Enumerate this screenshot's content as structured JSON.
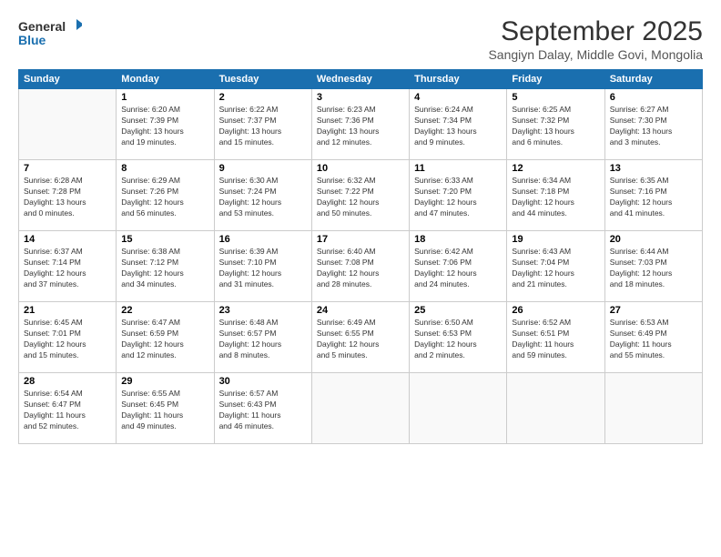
{
  "logo": {
    "line1": "General",
    "line2": "Blue"
  },
  "title": "September 2025",
  "subtitle": "Sangiyn Dalay, Middle Govi, Mongolia",
  "headers": [
    "Sunday",
    "Monday",
    "Tuesday",
    "Wednesday",
    "Thursday",
    "Friday",
    "Saturday"
  ],
  "weeks": [
    [
      {
        "day": "",
        "text": ""
      },
      {
        "day": "1",
        "text": "Sunrise: 6:20 AM\nSunset: 7:39 PM\nDaylight: 13 hours\nand 19 minutes."
      },
      {
        "day": "2",
        "text": "Sunrise: 6:22 AM\nSunset: 7:37 PM\nDaylight: 13 hours\nand 15 minutes."
      },
      {
        "day": "3",
        "text": "Sunrise: 6:23 AM\nSunset: 7:36 PM\nDaylight: 13 hours\nand 12 minutes."
      },
      {
        "day": "4",
        "text": "Sunrise: 6:24 AM\nSunset: 7:34 PM\nDaylight: 13 hours\nand 9 minutes."
      },
      {
        "day": "5",
        "text": "Sunrise: 6:25 AM\nSunset: 7:32 PM\nDaylight: 13 hours\nand 6 minutes."
      },
      {
        "day": "6",
        "text": "Sunrise: 6:27 AM\nSunset: 7:30 PM\nDaylight: 13 hours\nand 3 minutes."
      }
    ],
    [
      {
        "day": "7",
        "text": "Sunrise: 6:28 AM\nSunset: 7:28 PM\nDaylight: 13 hours\nand 0 minutes."
      },
      {
        "day": "8",
        "text": "Sunrise: 6:29 AM\nSunset: 7:26 PM\nDaylight: 12 hours\nand 56 minutes."
      },
      {
        "day": "9",
        "text": "Sunrise: 6:30 AM\nSunset: 7:24 PM\nDaylight: 12 hours\nand 53 minutes."
      },
      {
        "day": "10",
        "text": "Sunrise: 6:32 AM\nSunset: 7:22 PM\nDaylight: 12 hours\nand 50 minutes."
      },
      {
        "day": "11",
        "text": "Sunrise: 6:33 AM\nSunset: 7:20 PM\nDaylight: 12 hours\nand 47 minutes."
      },
      {
        "day": "12",
        "text": "Sunrise: 6:34 AM\nSunset: 7:18 PM\nDaylight: 12 hours\nand 44 minutes."
      },
      {
        "day": "13",
        "text": "Sunrise: 6:35 AM\nSunset: 7:16 PM\nDaylight: 12 hours\nand 41 minutes."
      }
    ],
    [
      {
        "day": "14",
        "text": "Sunrise: 6:37 AM\nSunset: 7:14 PM\nDaylight: 12 hours\nand 37 minutes."
      },
      {
        "day": "15",
        "text": "Sunrise: 6:38 AM\nSunset: 7:12 PM\nDaylight: 12 hours\nand 34 minutes."
      },
      {
        "day": "16",
        "text": "Sunrise: 6:39 AM\nSunset: 7:10 PM\nDaylight: 12 hours\nand 31 minutes."
      },
      {
        "day": "17",
        "text": "Sunrise: 6:40 AM\nSunset: 7:08 PM\nDaylight: 12 hours\nand 28 minutes."
      },
      {
        "day": "18",
        "text": "Sunrise: 6:42 AM\nSunset: 7:06 PM\nDaylight: 12 hours\nand 24 minutes."
      },
      {
        "day": "19",
        "text": "Sunrise: 6:43 AM\nSunset: 7:04 PM\nDaylight: 12 hours\nand 21 minutes."
      },
      {
        "day": "20",
        "text": "Sunrise: 6:44 AM\nSunset: 7:03 PM\nDaylight: 12 hours\nand 18 minutes."
      }
    ],
    [
      {
        "day": "21",
        "text": "Sunrise: 6:45 AM\nSunset: 7:01 PM\nDaylight: 12 hours\nand 15 minutes."
      },
      {
        "day": "22",
        "text": "Sunrise: 6:47 AM\nSunset: 6:59 PM\nDaylight: 12 hours\nand 12 minutes."
      },
      {
        "day": "23",
        "text": "Sunrise: 6:48 AM\nSunset: 6:57 PM\nDaylight: 12 hours\nand 8 minutes."
      },
      {
        "day": "24",
        "text": "Sunrise: 6:49 AM\nSunset: 6:55 PM\nDaylight: 12 hours\nand 5 minutes."
      },
      {
        "day": "25",
        "text": "Sunrise: 6:50 AM\nSunset: 6:53 PM\nDaylight: 12 hours\nand 2 minutes."
      },
      {
        "day": "26",
        "text": "Sunrise: 6:52 AM\nSunset: 6:51 PM\nDaylight: 11 hours\nand 59 minutes."
      },
      {
        "day": "27",
        "text": "Sunrise: 6:53 AM\nSunset: 6:49 PM\nDaylight: 11 hours\nand 55 minutes."
      }
    ],
    [
      {
        "day": "28",
        "text": "Sunrise: 6:54 AM\nSunset: 6:47 PM\nDaylight: 11 hours\nand 52 minutes."
      },
      {
        "day": "29",
        "text": "Sunrise: 6:55 AM\nSunset: 6:45 PM\nDaylight: 11 hours\nand 49 minutes."
      },
      {
        "day": "30",
        "text": "Sunrise: 6:57 AM\nSunset: 6:43 PM\nDaylight: 11 hours\nand 46 minutes."
      },
      {
        "day": "",
        "text": ""
      },
      {
        "day": "",
        "text": ""
      },
      {
        "day": "",
        "text": ""
      },
      {
        "day": "",
        "text": ""
      }
    ]
  ]
}
